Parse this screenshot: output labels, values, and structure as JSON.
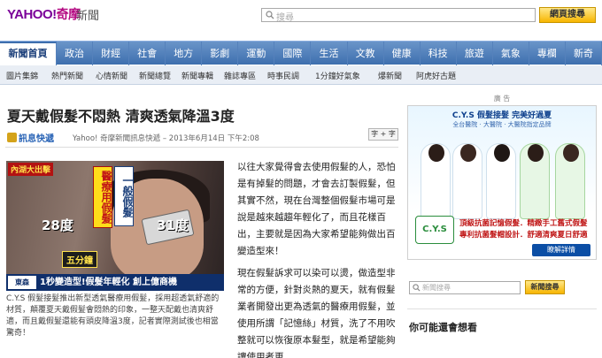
{
  "header": {
    "logo_text": "YAHOO!",
    "logo_cn": "奇摩",
    "section": "新聞",
    "search_placeholder": "搜尋",
    "search_button": "網頁搜尋"
  },
  "nav": {
    "items": [
      "新聞首頁",
      "政治",
      "財經",
      "社會",
      "地方",
      "影劇",
      "運動",
      "國際",
      "生活",
      "文教",
      "健康",
      "科技",
      "旅遊",
      "氣象",
      "專欄",
      "新奇"
    ]
  },
  "subnav": {
    "items": [
      "圖片集錦",
      "熱門新聞",
      "心情新聞",
      "新聞總覽",
      "新聞專輯",
      "雜誌專區",
      "時事民調",
      "1分鐘好氣象",
      "爆新聞",
      "阿虎好古題"
    ]
  },
  "article": {
    "title": "夏天戴假髮不悶熱 清爽透氣降溫3度",
    "source_logo": "訊息快遞",
    "byline": "Yahoo! 奇摩新聞訊息快遞 – 2013年6月14日 下午2:08",
    "font_size_label": "字 + 字",
    "photo": {
      "tag": "內湖大出擊",
      "banner1": "醫療用假髮",
      "banner2": "一般假髮",
      "temp_left": "28度",
      "temp_right": "31度",
      "badge": "五分鐘",
      "caption_logo": "東森 17:18",
      "caption": "1秒變造型!假髮年輕化 創上億商機"
    },
    "photo_caption": "C.Y.S 假髮接髮推出新型透氣醫療用假髮，採用超透氣舒適的材質，顛覆夏天戴假髮會悶熱的印象，一整天配戴也清爽舒適，而且戴假髮還能有頭皮降溫3度，記者實際測試後也相當驚奇！",
    "paragraphs": [
      "以往大家覺得會去使用假髮的人，恐怕是有掉髮的問題，才會去訂製假髮，但其實不然，現在台灣整個假髮市場可是說是越來越趨年輕化了，而且花樣百出，主要就是因為大家希望能夠做出百變造型來！",
      "現在假髮訴求可以染可以燙，做造型非常的方便，針對炎熱的夏天，就有假髮業者開發出更為透氣的醫療用假髮，並使用所謂「記憶絲」材質，洗了不用吹整就可以恢復原本髮型，就是希望能夠讓使用者更"
    ]
  },
  "sidebar": {
    "ad_label": "廣 告",
    "ad": {
      "title": "C.Y.S 假髮接髮 完美好過夏",
      "subtitle": "全台醫院 · 大醫院 · 大醫院指定品牌",
      "logo": "C.Y.S",
      "line1": "頂級抗菌記憶假髮．精緻手工舊式假髮",
      "line2": "專利抗菌髮帽設計．舒適清爽夏日舒適",
      "button": "瞭解詳情"
    },
    "news_search_placeholder": "新聞搜尋",
    "news_search_button": "新聞搜尋",
    "also_title": "你可能還會想看"
  },
  "colors": {
    "nav_bg": "#3e6fae",
    "brand_purple": "#7b0099",
    "search_button": "#f7b500"
  }
}
